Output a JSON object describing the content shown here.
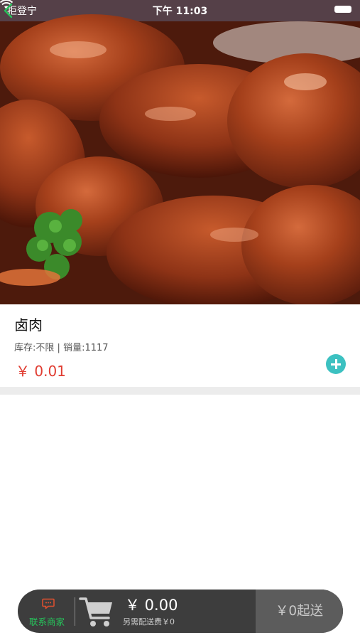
{
  "status_bar": {
    "carrier": "拒登宁",
    "time": "下午 11:03"
  },
  "product": {
    "name": "卤肉",
    "stock_label": "库存:不限",
    "meta_separator": "|",
    "sales_label": "销量:1117",
    "price": "￥ 0.01"
  },
  "cart_bar": {
    "contact_label": "联系商家",
    "total": "￥ 0.00",
    "delivery_note": "另需配送费￥0",
    "checkout_label": "￥0起送"
  },
  "colors": {
    "price_red": "#e03c31",
    "add_button_teal": "#3cc1c1",
    "contact_green": "#27c25b",
    "back_green": "#27c25b",
    "cart_bar_bg": "#3d3d3d",
    "checkout_bg": "#5c5c5c"
  },
  "icons": [
    "back-chevron-icon",
    "wifi-icon",
    "battery-icon",
    "plus-circle-icon",
    "chat-bubble-icon",
    "shopping-cart-icon"
  ]
}
